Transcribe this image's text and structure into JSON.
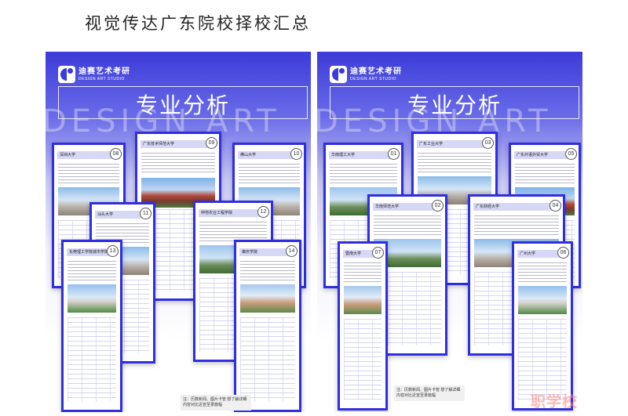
{
  "page": {
    "title": "视觉传达广东院校择校汇总"
  },
  "panels": {
    "left": {
      "logo_cn": "迪赛艺术考研",
      "logo_en": "DESIGN ART STUDIO",
      "heading": "专业分析",
      "watermark": "DESIGN ART",
      "cards": [
        {
          "name": "深圳大学",
          "num": "08"
        },
        {
          "name": "广东技术师范大学",
          "num": "09"
        },
        {
          "name": "佛山大学",
          "num": "10"
        },
        {
          "name": "汕头大学",
          "num": "11"
        },
        {
          "name": "仲恺农业工程学院",
          "num": "12"
        },
        {
          "name": "东莞理工学院城市学院",
          "num": "13"
        },
        {
          "name": "肇庆学院",
          "num": "14"
        }
      ],
      "note": "注：历数新闻、图片卡管  想了解详细内容对比近宣至录篇幅"
    },
    "right": {
      "logo_cn": "迪赛艺术考研",
      "logo_en": "DESIGN ART STUDIO",
      "heading": "专业分析",
      "watermark": "DESIGN ART",
      "cards": [
        {
          "name": "华南理工大学",
          "num": "01"
        },
        {
          "name": "广东工业大学",
          "num": "03"
        },
        {
          "name": "广东外语外贸大学",
          "num": "05"
        },
        {
          "name": "华南师范大学",
          "num": "02"
        },
        {
          "name": "广东财经大学",
          "num": "04"
        },
        {
          "name": "广州大学",
          "num": "06"
        },
        {
          "name": "暨南大学",
          "num": "07"
        }
      ],
      "note": "注：历数新闻、图片卡管  想了解详细内容对比近宣至录篇幅"
    }
  },
  "footer": {
    "watermark": "职学校"
  }
}
